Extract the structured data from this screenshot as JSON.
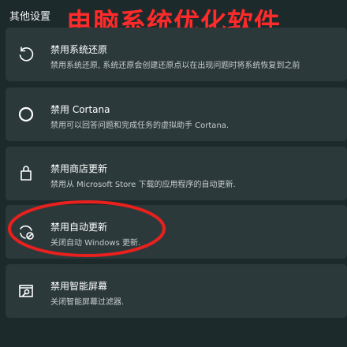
{
  "section": {
    "title": "其他设置"
  },
  "banner": {
    "text": "电脑系统优化软件",
    "color": "#ff2a2a"
  },
  "cards": [
    {
      "icon": "restore-icon",
      "title": "禁用系统还原",
      "desc": "禁用系统还原, 系统还原会创建还原点以在出现问题时将系统恢复到之前"
    },
    {
      "icon": "circle-icon",
      "title": "禁用 Cortana",
      "desc": "禁用可以回答问题和完成任务的虚拟助手 Cortana."
    },
    {
      "icon": "store-bag-icon",
      "title": "禁用商店更新",
      "desc": "禁用从 Microsoft Store 下载的应用程序的自动更新."
    },
    {
      "icon": "update-blocked-icon",
      "title": "禁用自动更新",
      "desc": "关闭自动 Windows 更新."
    },
    {
      "icon": "screen-search-icon",
      "title": "禁用智能屏幕",
      "desc": "关闭智能屏幕过滤器."
    }
  ],
  "annotation": {
    "color": "#e8201e",
    "highlighted_card": 3
  }
}
